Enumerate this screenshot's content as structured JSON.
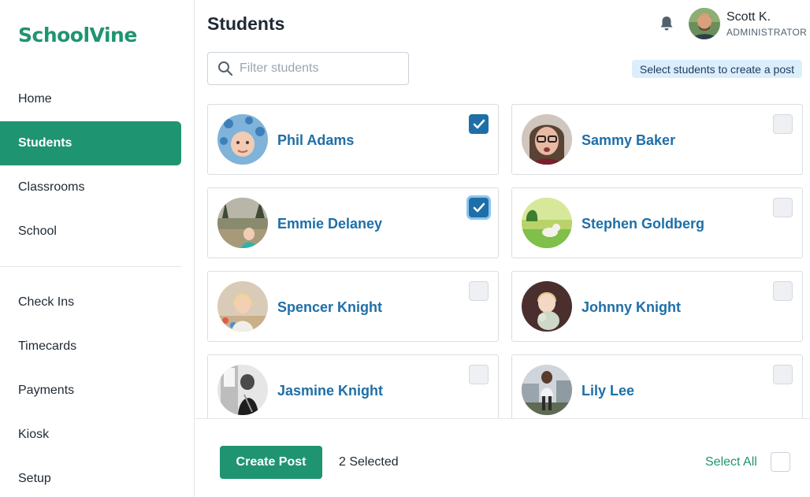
{
  "sidebar": {
    "logo": "SchoolVine",
    "primary_nav": [
      {
        "label": "Home"
      },
      {
        "label": "Students",
        "active": true
      },
      {
        "label": "Classrooms"
      },
      {
        "label": "School"
      }
    ],
    "secondary_nav": [
      {
        "label": "Check Ins"
      },
      {
        "label": "Timecards"
      },
      {
        "label": "Payments"
      },
      {
        "label": "Kiosk"
      },
      {
        "label": "Setup"
      }
    ]
  },
  "header": {
    "title": "Students",
    "notification_icon": "bell-icon",
    "user": {
      "name": "Scott K.",
      "role": "ADMINISTRATOR"
    }
  },
  "search": {
    "placeholder": "Filter students",
    "value": "",
    "icon": "search-icon"
  },
  "hint": "Select students to create a post",
  "students": [
    {
      "name": "Phil Adams",
      "checked": true
    },
    {
      "name": "Sammy Baker",
      "checked": false
    },
    {
      "name": "Emmie Delaney",
      "checked": true
    },
    {
      "name": "Stephen Goldberg",
      "checked": false
    },
    {
      "name": "Spencer Knight",
      "checked": false
    },
    {
      "name": "Johnny Knight",
      "checked": false
    },
    {
      "name": "Jasmine Knight",
      "checked": false
    },
    {
      "name": "Lily Lee",
      "checked": false
    }
  ],
  "footer": {
    "create_post_label": "Create Post",
    "selected_label": "2 Selected",
    "select_all_label": "Select All"
  },
  "colors": {
    "brand_green": "#1f9470",
    "link_blue": "#1e6fa8",
    "badge_bg": "#dceefb"
  }
}
